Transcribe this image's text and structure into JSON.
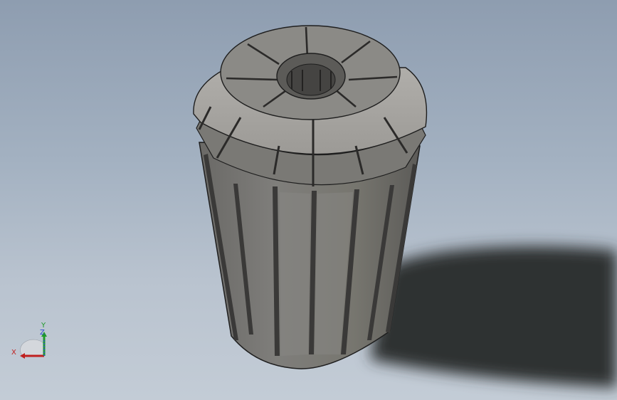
{
  "viewport": {
    "model": "collet",
    "colors": {
      "background_top": "#8e9db0",
      "background_bottom": "#c3ccd6",
      "body_fill": "#7d7c79",
      "body_light": "#a3a19d",
      "body_dark": "#5f5e5b",
      "slot": "#3a3938",
      "edge": "#1e1e1e",
      "shadow": "#2f3033"
    }
  },
  "triad": {
    "x_label": "X",
    "y_label": "Y",
    "z_label": "Z",
    "colors": {
      "x": "#c0201f",
      "y": "#1f9b2a",
      "z": "#2c4ad0"
    }
  }
}
